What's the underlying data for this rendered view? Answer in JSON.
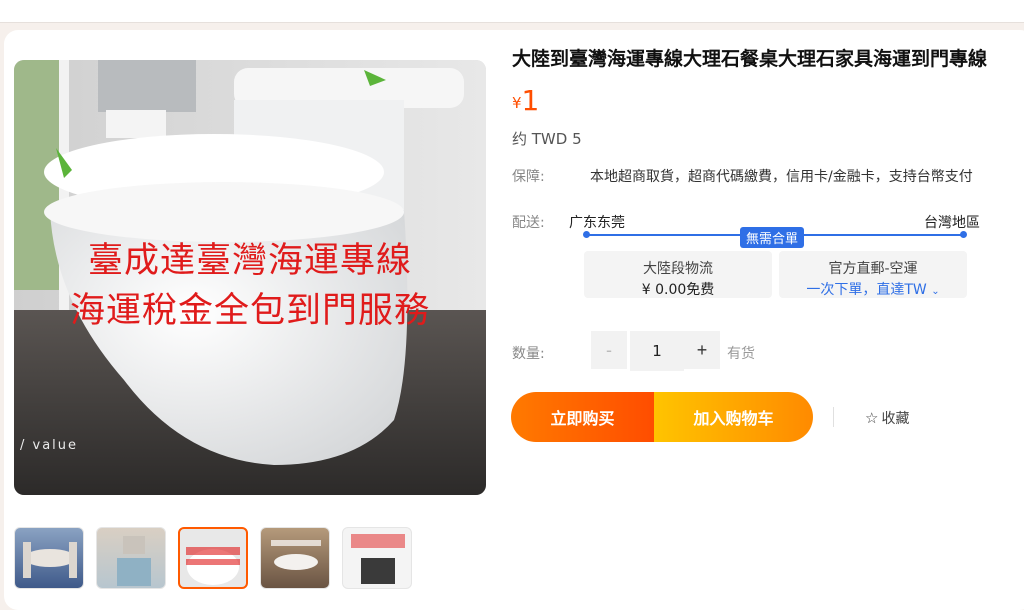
{
  "product": {
    "title": "大陸到臺灣海運專線大理石餐桌大理石家具海運到門專線",
    "price_currency": "¥",
    "price_value": "1",
    "price_twd": "约 TWD 5"
  },
  "image": {
    "overlay_line1": "臺成達臺灣海運專線",
    "overlay_line2": "海運稅金全包到門服務",
    "watermark": "/ value"
  },
  "guarantee": {
    "label": "保障:",
    "text": "本地超商取貨，超商代碼繳費，信用卡/金融卡，支持台幣支付"
  },
  "shipping": {
    "label": "配送:",
    "from": "广东东莞",
    "to": "台灣地區",
    "badge": "無需合單",
    "mainland_title": "大陸段物流",
    "mainland_fee": "¥ 0.00免费",
    "official_title": "官方直郵-空運",
    "official_sub": "一次下單，直達TW"
  },
  "quantity": {
    "label": "数量:",
    "minus": "-",
    "value": "1",
    "plus": "+",
    "stock": "有货"
  },
  "actions": {
    "buy_now": "立即购买",
    "add_cart": "加入购物车",
    "favorite": "收藏"
  },
  "colors": {
    "accent": "#ff4e00",
    "link": "#2f6fe6"
  }
}
